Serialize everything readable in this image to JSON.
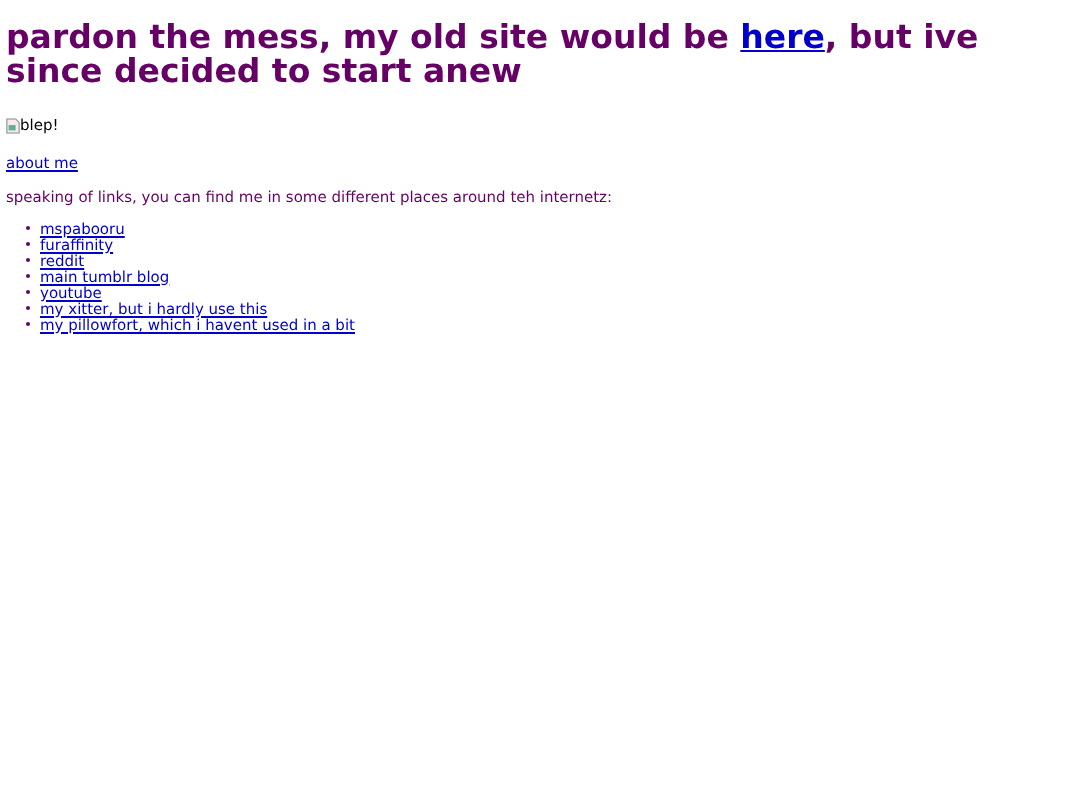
{
  "heading": {
    "before": "pardon the mess, my old site would be ",
    "link": "here",
    "after": ", but ive since decided to start anew"
  },
  "image": {
    "alt": "blep!"
  },
  "about_link": "about me",
  "intro": "speaking of links, you can find me in some different places around teh internetz:",
  "links": [
    "mspabooru",
    "furaffinity",
    "reddit",
    "main tumblr blog",
    "youtube",
    "my xitter, but i hardly use this",
    "my pillowfort, which i havent used in a bit"
  ]
}
